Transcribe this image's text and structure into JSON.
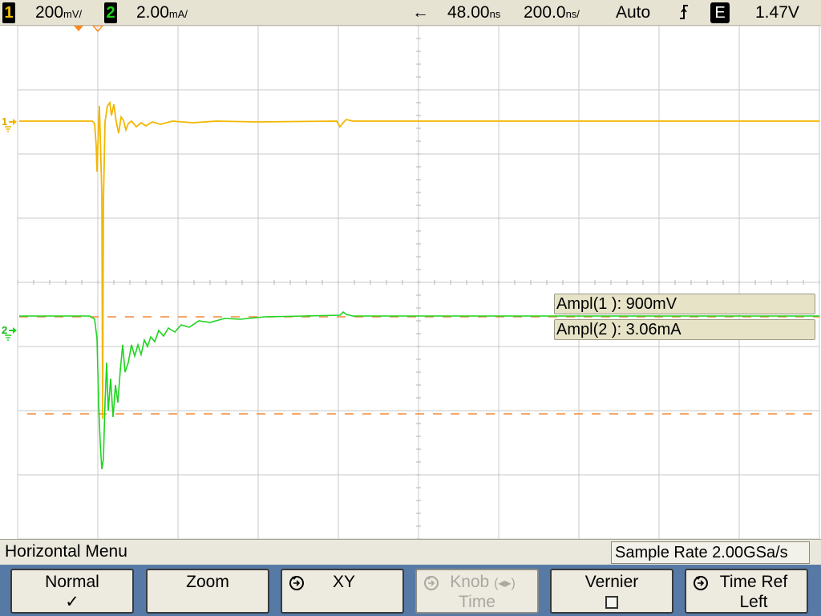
{
  "topbar": {
    "ch1_num": "1",
    "ch1_scale": "200",
    "ch1_unit": "mV/",
    "ch2_num": "2",
    "ch2_scale": "2.00",
    "ch2_unit": "mA/",
    "delay_arrow": "←",
    "delay": "48.00",
    "delay_unit": "ns",
    "timebase": "200.0",
    "timebase_unit": "ns/",
    "trigger_mode": "Auto",
    "trigger_slope": "ᶠ",
    "trigger_source": "E",
    "trigger_level": "1.47V"
  },
  "markers": {
    "ch1": "1",
    "ch2": "2"
  },
  "measurements": [
    {
      "label": "Ampl(1 ): 900mV"
    },
    {
      "label": "Ampl(2 ): 3.06mA"
    }
  ],
  "menu": {
    "title": "Horizontal Menu",
    "sample_rate": "Sample Rate 2.00GSa/s",
    "keys": [
      {
        "line1": "Normal",
        "line2": "✓"
      },
      {
        "line1": "Zoom",
        "line2": ""
      },
      {
        "line1": "XY",
        "line2": ""
      },
      {
        "line1": "Knob",
        "line1b": "(◂▸)",
        "line2": "Time"
      },
      {
        "line1": "Vernier",
        "line2": ""
      },
      {
        "line1": "Time Ref",
        "line2": "Left"
      }
    ]
  },
  "colors": {
    "ch1": "#f2b700",
    "ch2": "#1fd41f",
    "marker": "#ff8a1a",
    "grid": "#c8c8c8",
    "softkey_bg": "#5779a6"
  }
}
